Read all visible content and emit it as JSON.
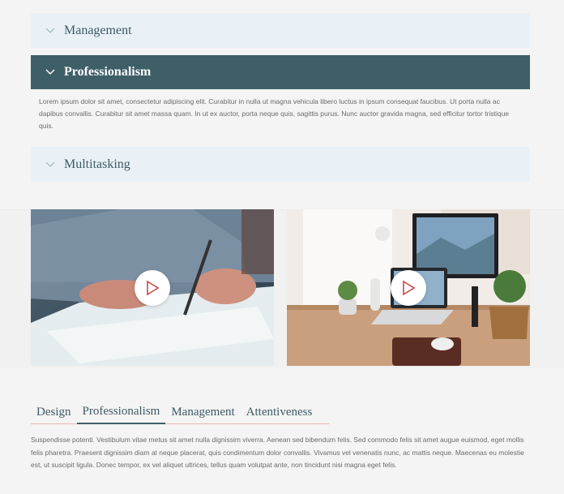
{
  "accordion": {
    "items": [
      {
        "label": "Management",
        "expanded": false
      },
      {
        "label": "Professionalism",
        "expanded": true,
        "body": "Lorem ipsum dolor sit amet, consectetur adipiscing elit. Curabitur in nulla ut magna vehicula libero luctus in ipsum consequat faucibus. Ut porta nulla ac dapibus convallis. Curabitur sit amet massa quam. In ut ex auctor, porta neque quis, sagittis purus. Nunc auctor gravida magna, sed efficitur tortor tristique quis."
      },
      {
        "label": "Multitasking",
        "expanded": false
      }
    ]
  },
  "videos": [
    {
      "icon": "play-icon",
      "scene": "writing-hands"
    },
    {
      "icon": "play-icon",
      "scene": "desk-workspace"
    }
  ],
  "tabs": {
    "items": [
      {
        "label": "Design"
      },
      {
        "label": "Professionalism"
      },
      {
        "label": "Management"
      },
      {
        "label": "Attentiveness"
      }
    ],
    "active_index": 1,
    "content": "Suspendisse potenti. Vestibulum vitae metus sit amet nulla dignissim viverra. Aenean sed bibendum felis. Sed commodo felis sit amet augue euismod, eget mollis felis pharetra. Praesent dignissim diam at neque placerat, quis condimentum dolor convallis. Vivamus vel venenatis nunc, ac mattis neque. Maecenas eu molestie est, ut suscipit ligula. Donec tempor, ex vel aliquet ultrices, tellus quam volutpat ante, non tincidunt nisi magna eget felis."
  },
  "colors": {
    "accent": "#3f5f68",
    "accordion_bg": "#e9f1f7",
    "tab_underline": "#e7b7b0",
    "play": "#c94a4a"
  }
}
